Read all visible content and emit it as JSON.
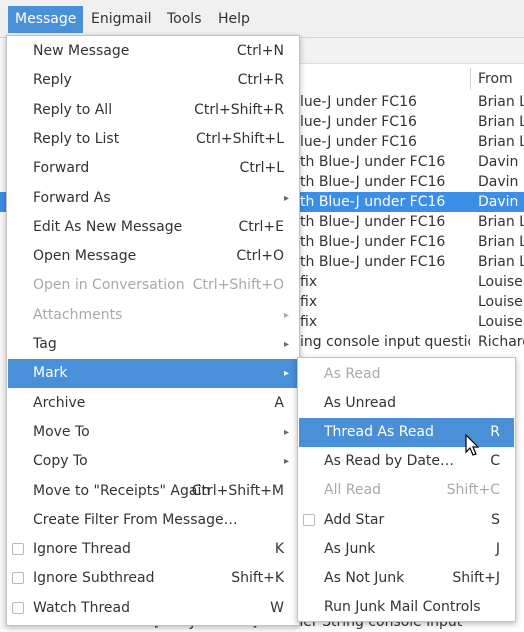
{
  "menubar": {
    "items": [
      "Message",
      "Enigmail",
      "Tools",
      "Help"
    ]
  },
  "message_list": {
    "columns": {
      "from": "From"
    },
    "rows": [
      {
        "subject": "lue-J under FC16",
        "from": "Brian Lo"
      },
      {
        "subject": "lue-J under FC16",
        "from": "Brian Lo"
      },
      {
        "subject": "lue-J under FC16",
        "from": "Brian Lo"
      },
      {
        "subject": "th Blue-J under FC16",
        "from": "Davin M"
      },
      {
        "subject": "th Blue-J under FC16",
        "from": "Davin M"
      },
      {
        "subject": "th Blue-J under FC16",
        "from": "Davin M",
        "selected": true
      },
      {
        "subject": "th Blue-J under FC16",
        "from": "Brian Lo"
      },
      {
        "subject": "th Blue-J under FC16",
        "from": "Brian Lo"
      },
      {
        "subject": "th Blue-J under FC16",
        "from": "Brian Lo"
      },
      {
        "subject": "fix",
        "from": "Louise"
      },
      {
        "subject": "fix",
        "from": "Louise"
      },
      {
        "subject": "fix",
        "from": "Louise"
      },
      {
        "subject": "ing console input question",
        "from": "Richard"
      }
    ],
    "bottom_row": "Re: [BlueJ Discuss] scanner String console input qu..."
  },
  "message_menu": {
    "items": [
      {
        "label": "New Message",
        "accel": "Ctrl+N"
      },
      {
        "label": "Reply",
        "accel": "Ctrl+R"
      },
      {
        "label": "Reply to All",
        "accel": "Ctrl+Shift+R"
      },
      {
        "label": "Reply to List",
        "accel": "Ctrl+Shift+L"
      },
      {
        "label": "Forward",
        "accel": "Ctrl+L"
      },
      {
        "label": "Forward As",
        "submenu": true
      },
      {
        "label": "Edit As New Message",
        "accel": "Ctrl+E"
      },
      {
        "label": "Open Message",
        "accel": "Ctrl+O"
      },
      {
        "label": "Open in Conversation",
        "accel": "Ctrl+Shift+O",
        "disabled": true
      },
      {
        "label": "Attachments",
        "submenu": true,
        "disabled": true
      },
      {
        "label": "Tag",
        "submenu": true
      },
      {
        "label": "Mark",
        "submenu": true,
        "highlighted": true
      },
      {
        "label": "Archive",
        "accel": "A"
      },
      {
        "label": "Move To",
        "submenu": true
      },
      {
        "label": "Copy To",
        "submenu": true
      },
      {
        "label": "Move to \"Receipts\" Again",
        "accel": "Ctrl+Shift+M"
      },
      {
        "label": "Create Filter From Message…"
      },
      {
        "label": "Ignore Thread",
        "accel": "K",
        "checkbox": true
      },
      {
        "label": "Ignore Subthread",
        "accel": "Shift+K",
        "checkbox": true
      },
      {
        "label": "Watch Thread",
        "accel": "W",
        "checkbox": true
      }
    ]
  },
  "mark_menu": {
    "items": [
      {
        "label": "As Read",
        "disabled": true
      },
      {
        "label": "As Unread"
      },
      {
        "label": "Thread As Read",
        "accel": "R",
        "highlighted": true
      },
      {
        "label": "As Read by Date…",
        "accel": "C"
      },
      {
        "label": "All Read",
        "accel": "Shift+C",
        "disabled": true
      },
      {
        "label": "Add Star",
        "accel": "S",
        "checkbox": true
      },
      {
        "label": "As Junk",
        "accel": "J"
      },
      {
        "label": "As Not Junk",
        "accel": "Shift+J"
      },
      {
        "label": "Run Junk Mail Controls"
      }
    ]
  },
  "colors": {
    "accent": "#4a90d9",
    "selected_row": "#3d8ee6",
    "disabled_text": "#a9a9a9"
  }
}
